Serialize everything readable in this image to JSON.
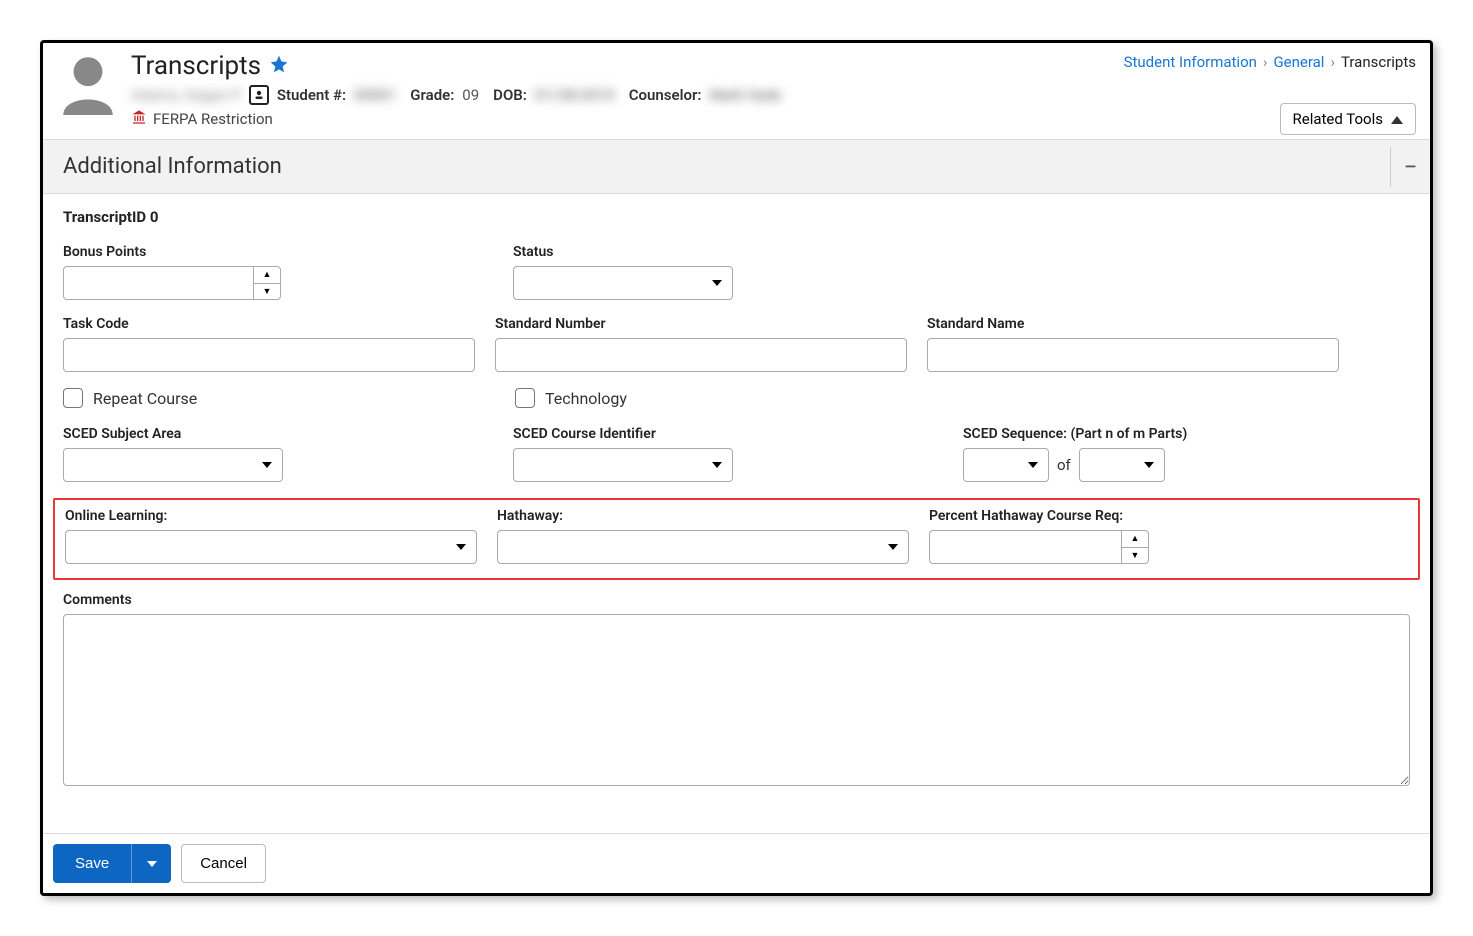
{
  "header": {
    "title": "Transcripts",
    "student_name": "Adams, Degan P",
    "student_num_label": "Student #:",
    "student_num": "00001",
    "grade_label": "Grade:",
    "grade": "09",
    "dob_label": "DOB:",
    "dob": "01/28/2010",
    "counselor_label": "Counselor:",
    "counselor": "Mark Hyde",
    "ferpa_label": "FERPA Restriction",
    "related_tools": "Related Tools"
  },
  "breadcrumb": {
    "item1": "Student Information",
    "item2": "General",
    "current": "Transcripts"
  },
  "section": {
    "title": "Additional Information",
    "transcript_id_label": "TranscriptID 0"
  },
  "fields": {
    "bonus_points": "Bonus Points",
    "status": "Status",
    "task_code": "Task Code",
    "standard_number": "Standard Number",
    "standard_name": "Standard Name",
    "repeat_course": "Repeat Course",
    "technology": "Technology",
    "sced_subject": "SCED Subject Area",
    "sced_course_id": "SCED Course Identifier",
    "sced_sequence": "SCED Sequence: (Part n of m Parts)",
    "sced_of": "of",
    "online_learning": "Online Learning:",
    "hathaway": "Hathaway:",
    "percent_hathaway": "Percent Hathaway Course Req:",
    "comments": "Comments"
  },
  "footer": {
    "save": "Save",
    "cancel": "Cancel"
  }
}
